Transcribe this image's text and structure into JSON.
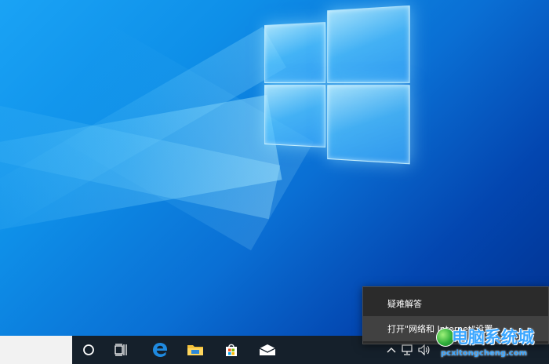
{
  "desktop": {
    "background_colors": [
      "#1aa3f5",
      "#0a6fd4",
      "#01318f"
    ],
    "logo_icon": "windows-logo-icon"
  },
  "taskbar": {
    "background": "#15202b",
    "buttons": [
      {
        "id": "cortana",
        "icon": "cortana-circle-icon"
      },
      {
        "id": "task-view",
        "icon": "task-view-icon"
      },
      {
        "id": "edge",
        "icon": "edge-browser-icon"
      },
      {
        "id": "explorer",
        "icon": "file-explorer-icon"
      },
      {
        "id": "store",
        "icon": "microsoft-store-icon"
      },
      {
        "id": "mail",
        "icon": "mail-icon"
      }
    ],
    "tray_icons": [
      "chevron-up-icon",
      "network-icon",
      "volume-icon"
    ]
  },
  "context_menu": {
    "items": [
      {
        "label": "疑难解答",
        "highlighted": false
      },
      {
        "label": "打开\"网络和 Internet\"设置",
        "highlighted": true
      }
    ]
  },
  "watermark": {
    "text": "电脑系统城",
    "url": "pcxitongcheng.com"
  }
}
